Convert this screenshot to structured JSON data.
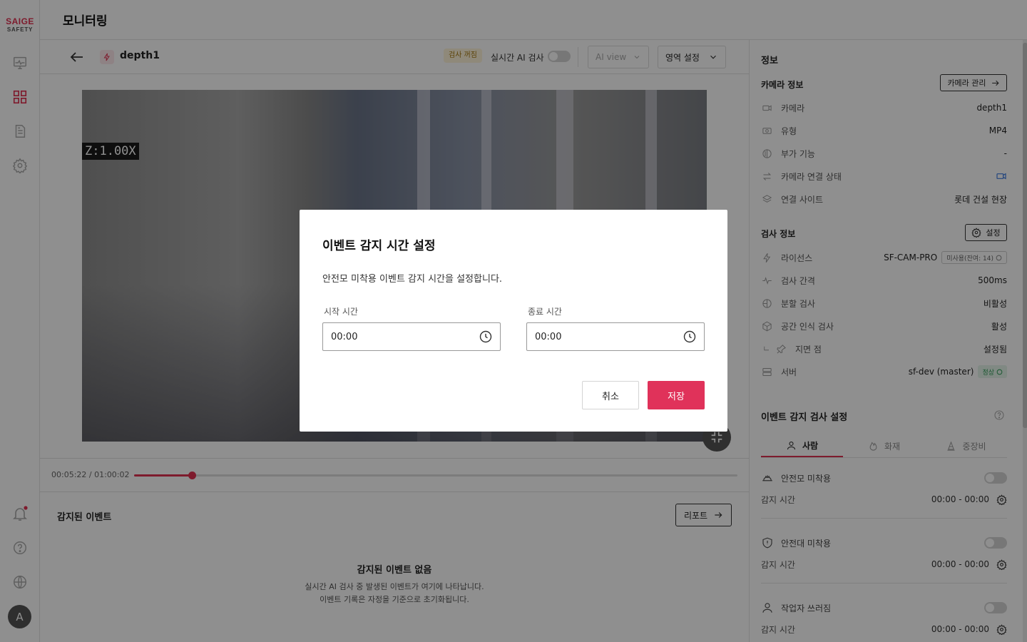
{
  "brand": {
    "line1": "SAIGE",
    "line2": "SAFETY",
    "accent": "#e03050"
  },
  "sidebar": {
    "nav": [
      {
        "name": "monitor-icon",
        "active": false
      },
      {
        "name": "grid-icon",
        "active": true
      },
      {
        "name": "document-icon",
        "active": false
      },
      {
        "name": "gear-icon",
        "active": false
      }
    ],
    "bottom": [
      {
        "name": "bell-icon"
      },
      {
        "name": "help-icon"
      },
      {
        "name": "globe-icon"
      }
    ],
    "avatar_letter": "A"
  },
  "header": {
    "title": "모니터링"
  },
  "camera_bar": {
    "camera_name": "depth1",
    "inspection_badge": "검사 꺼짐",
    "realtime_label": "실시간 AI 검사",
    "realtime_on": false,
    "ai_view_label": "AI view",
    "area_setting_label": "영역 설정"
  },
  "video": {
    "zoom_overlay": "Z:1.00X"
  },
  "playback": {
    "current": "00:05:22",
    "separator": " / ",
    "total": "01:00:02",
    "progress": 0.0956
  },
  "events": {
    "title": "감지된 이벤트",
    "report_button": "리포트",
    "empty_title": "감지된 이벤트 없음",
    "empty_desc_1": "실시간 AI 검사 중 발생된 이벤트가 여기에 나타납니다.",
    "empty_desc_2": "이벤트 기록은 자정을 기준으로 초기화됩니다."
  },
  "info_panel": {
    "title": "정보",
    "camera_section": {
      "title": "카메라 정보",
      "manage_button": "카메라 관리",
      "rows": [
        {
          "icon": "camera-icon",
          "label": "카메라",
          "value": "depth1"
        },
        {
          "icon": "type-icon",
          "label": "유형",
          "value": "MP4"
        },
        {
          "icon": "addon-icon",
          "label": "부가 기능",
          "value": "-"
        },
        {
          "icon": "swap-icon",
          "label": "카메라 연결 상태",
          "value": ""
        },
        {
          "icon": "layers-icon",
          "label": "연결 사이트",
          "value": "롯데 건설 현장"
        }
      ]
    },
    "inspection_section": {
      "title": "검사 정보",
      "settings_button": "설정",
      "license": {
        "label": "라이선스",
        "value": "SF-CAM-PRO",
        "chip": "미사용(잔여: 14)"
      },
      "rows": [
        {
          "icon": "pulse-icon",
          "label": "검사 간격",
          "value": "500ms"
        },
        {
          "icon": "split-icon",
          "label": "분할 검사",
          "value": "비활성"
        },
        {
          "icon": "cube-icon",
          "label": "공간 인식 검사",
          "value": "활성"
        },
        {
          "icon": "pin-icon",
          "label": "지면 점",
          "value": "설정됨"
        }
      ],
      "server": {
        "label": "서버",
        "value": "sf-dev (master)",
        "chip": "정상"
      }
    },
    "event_settings": {
      "title": "이벤트 감지 검사 설정",
      "tabs": [
        {
          "label": "사람",
          "icon": "person-icon",
          "active": true
        },
        {
          "label": "화재",
          "icon": "fire-icon",
          "active": false
        },
        {
          "label": "중장비",
          "icon": "cone-icon",
          "active": false
        }
      ],
      "items": [
        {
          "icon": "helmet-icon",
          "name": "안전모 미착용",
          "time_label": "감지 시간",
          "time": "00:00 - 00:00",
          "enabled": false
        },
        {
          "icon": "shield-icon",
          "name": "안전대 미착용",
          "time_label": "감지 시간",
          "time": "00:00 - 00:00",
          "enabled": false
        },
        {
          "icon": "person-icon",
          "name": "작업자 쓰러짐",
          "time_label": "감지 시간",
          "time": "00:00 - 00:00",
          "enabled": false
        }
      ]
    }
  },
  "modal": {
    "title": "이벤트 감지 시간 설정",
    "description": "안전모 미착용 이벤트 감지 시간을 설정합니다.",
    "start_label": "시작 시간",
    "start_value": "00:00",
    "end_label": "종료 시간",
    "end_value": "00:00",
    "cancel_button": "취소",
    "save_button": "저장",
    "save_color": "#e0325a"
  }
}
